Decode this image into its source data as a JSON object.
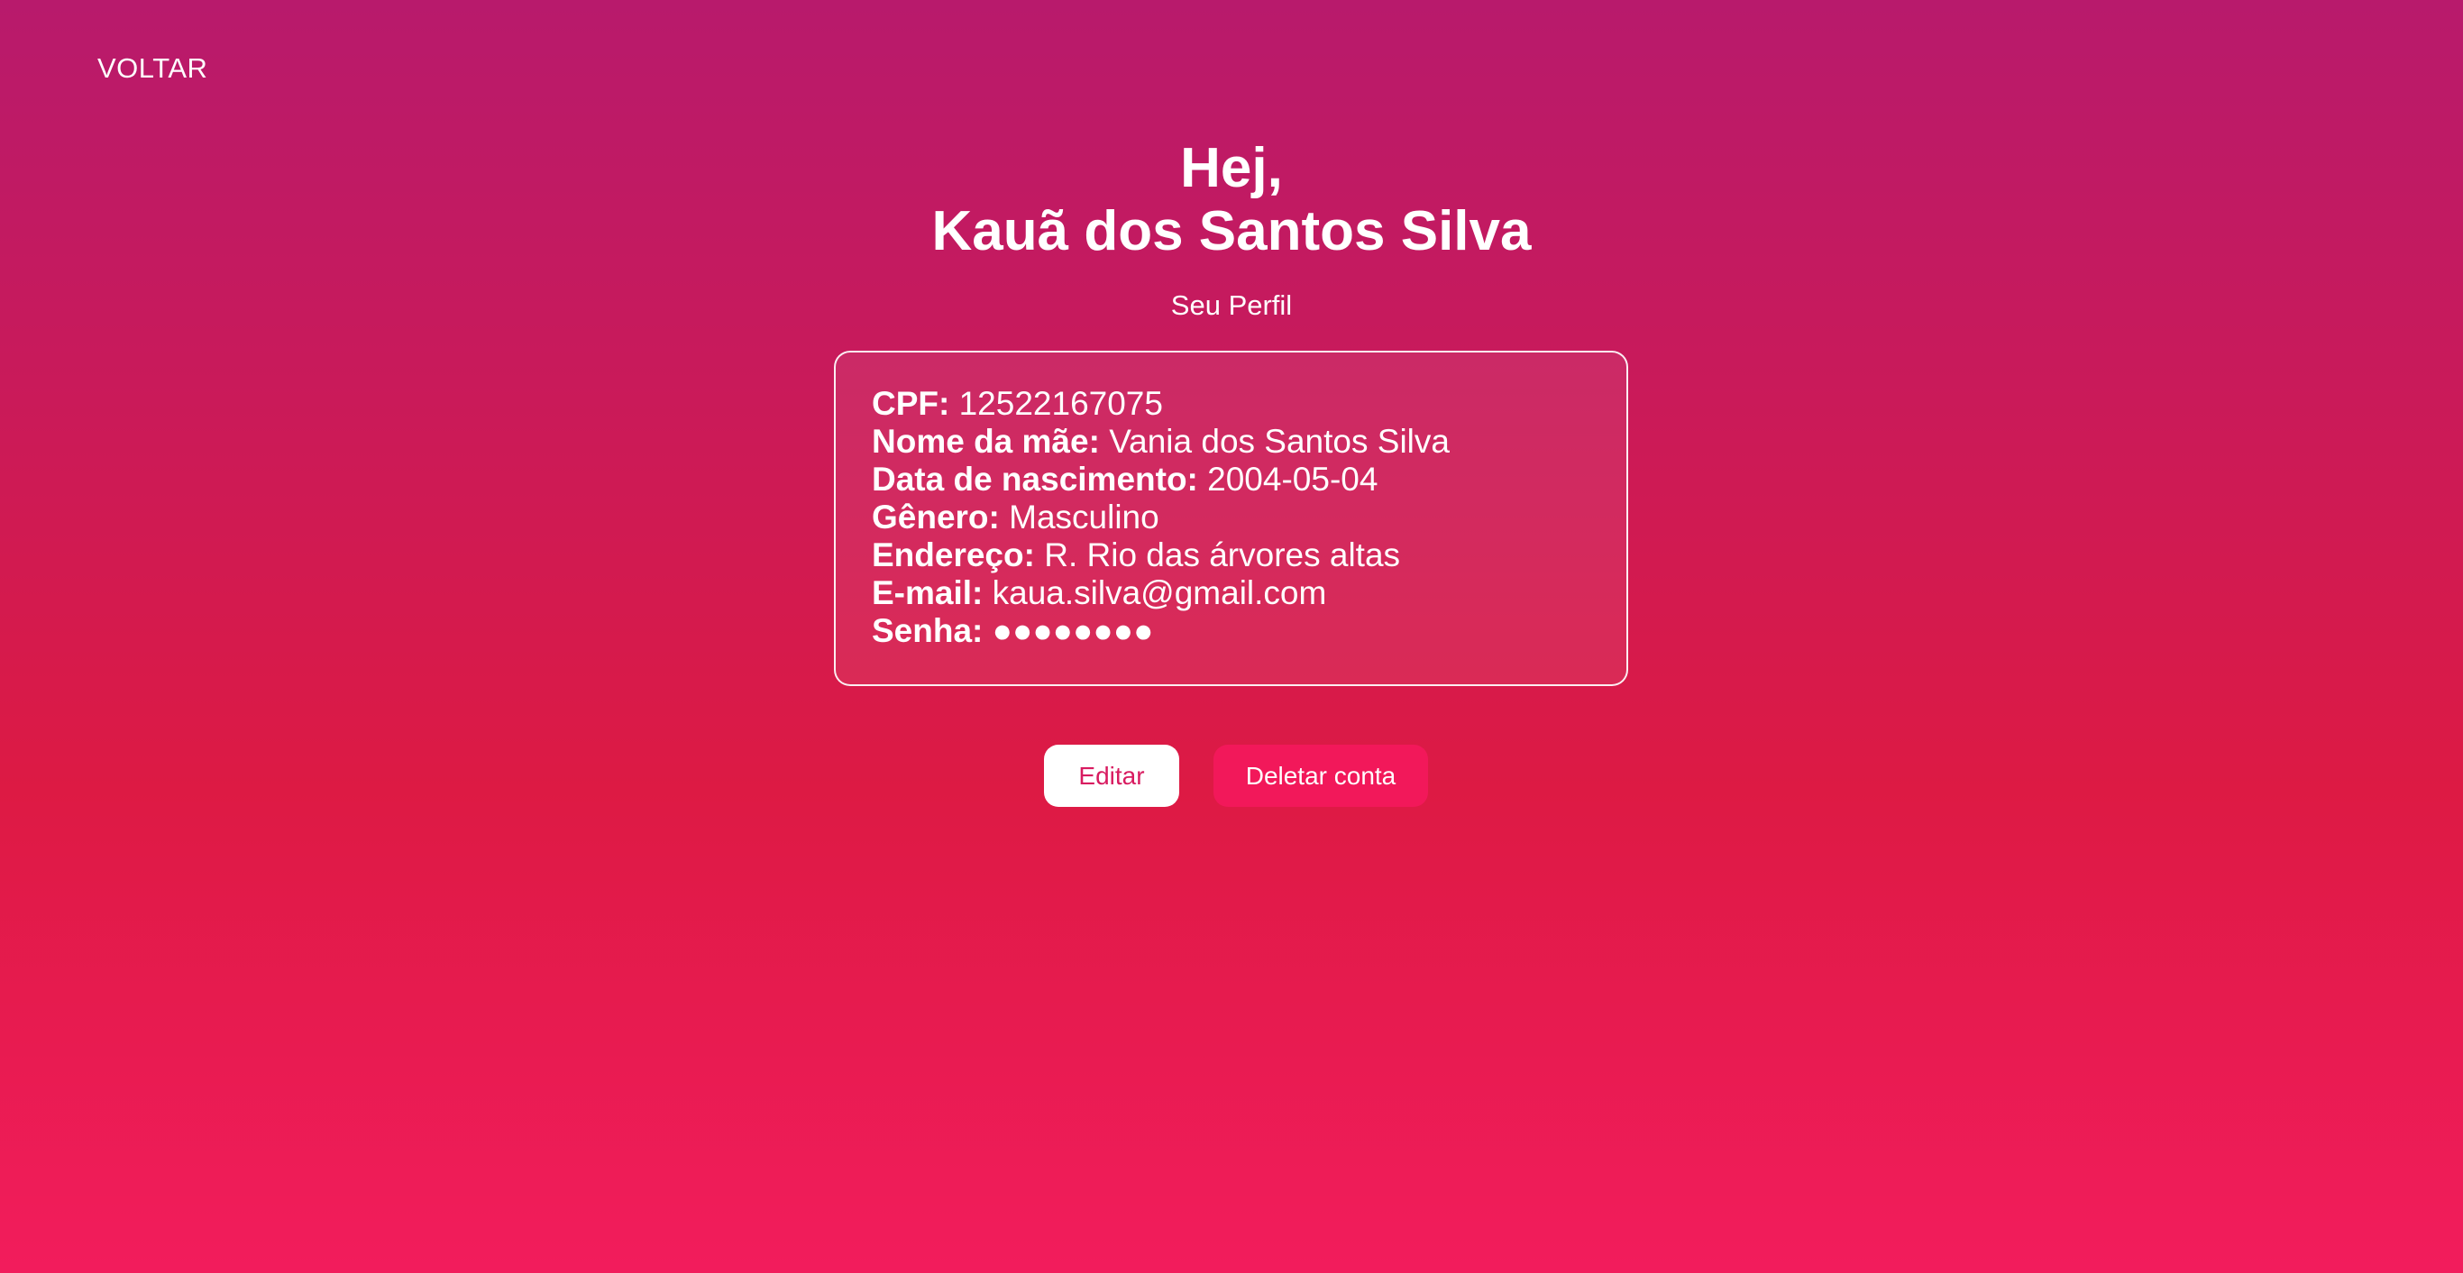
{
  "nav": {
    "back_label": "VOLTAR"
  },
  "header": {
    "greeting": "Hej,",
    "user_name": "Kauã dos Santos Silva",
    "subtitle": "Seu Perfil"
  },
  "profile": {
    "fields": [
      {
        "label": "CPF:",
        "value": "12522167075"
      },
      {
        "label": "Nome da mãe:",
        "value": "Vania dos Santos Silva"
      },
      {
        "label": "Data de nascimento:",
        "value": "2004-05-04"
      },
      {
        "label": "Gênero:",
        "value": "Masculino"
      },
      {
        "label": "Endereço:",
        "value": "R. Rio das árvores altas"
      },
      {
        "label": "E-mail:",
        "value": "kaua.silva@gmail.com"
      },
      {
        "label": "Senha:",
        "value": "●●●●●●●●"
      }
    ]
  },
  "actions": {
    "edit_label": "Editar",
    "delete_label": "Deletar conta"
  },
  "colors": {
    "background_top": "#b81a6c",
    "background_bottom": "#f21c5c",
    "edit_text": "#d81b60",
    "delete_bg": "#f2185a"
  }
}
